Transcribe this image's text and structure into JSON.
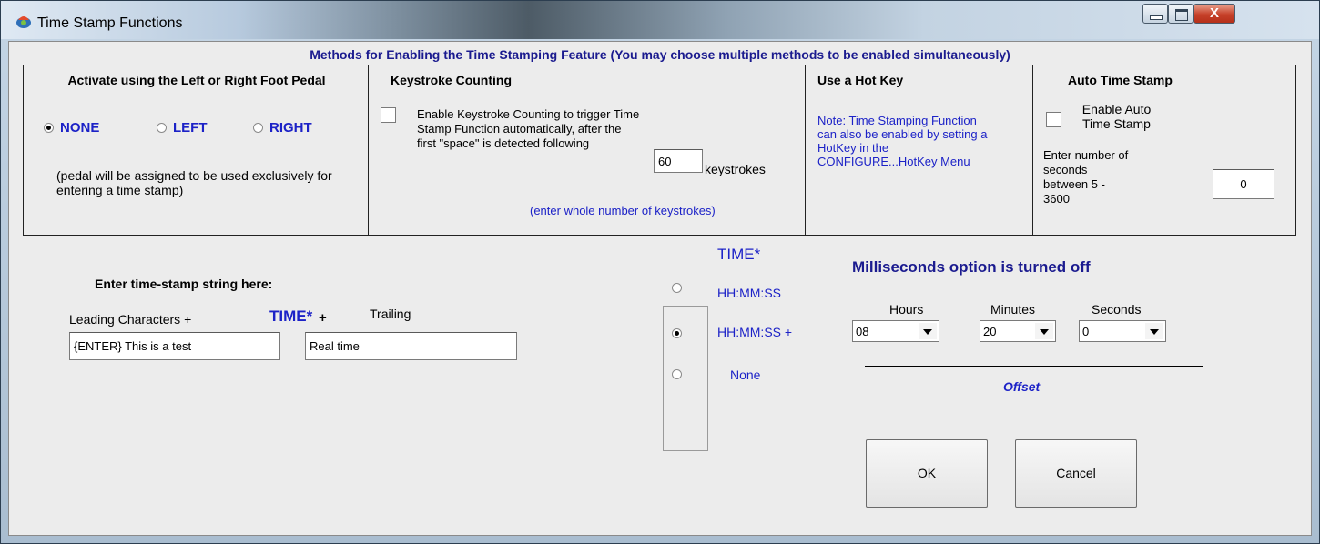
{
  "window": {
    "title": "Time Stamp Functions",
    "close_label": "X"
  },
  "banner": "Methods for Enabling the Time Stamping Feature (You may choose multiple methods to be enabled simultaneously)",
  "foot_pedal": {
    "title": "Activate using the Left or Right Foot Pedal",
    "options": [
      "NONE",
      "LEFT",
      "RIGHT"
    ],
    "selected": "NONE",
    "note": "(pedal will be assigned to be used exclusively for entering a time stamp)"
  },
  "keystroke": {
    "title": "Keystroke Counting",
    "checkbox_label": "Enable Keystroke Counting to trigger Time Stamp Function automatically, after the first \"space\" is detected following",
    "count_value": "60",
    "unit": "keystrokes",
    "hint": "(enter whole number of keystrokes)"
  },
  "hotkey": {
    "title": "Use a Hot Key",
    "note": "Note: Time Stamping Function can also be enabled by setting a HotKey in the CONFIGURE...HotKey Menu"
  },
  "auto_stamp": {
    "title": "Auto Time Stamp",
    "checkbox_label": "Enable Auto Time Stamp",
    "prompt": "Enter number of seconds between 5 - 3600",
    "seconds_value": "0"
  },
  "stamp_string": {
    "label": "Enter time-stamp string here:",
    "leading_label": "Leading Characters +",
    "time_token": "TIME*",
    "plus": "+",
    "trailing_label": "Trailing",
    "leading_value": "{ENTER} This is a test",
    "trailing_value": "Real time"
  },
  "time_format": {
    "title": "TIME*",
    "options": [
      "HH:MM:SS",
      "HH:MM:SS +",
      "None"
    ],
    "selected": "HH:MM:SS +"
  },
  "offset": {
    "ms_status": "Milliseconds option is turned off",
    "hours_label": "Hours",
    "minutes_label": "Minutes",
    "seconds_label": "Seconds",
    "hours_value": "08",
    "minutes_value": "20",
    "seconds_value": "0",
    "caption": "Offset"
  },
  "buttons": {
    "ok": "OK",
    "cancel": "Cancel"
  },
  "colors": {
    "label_blue": "#1c22c7",
    "banner_navy": "#1b1b8f",
    "client_bg": "#ececec"
  }
}
